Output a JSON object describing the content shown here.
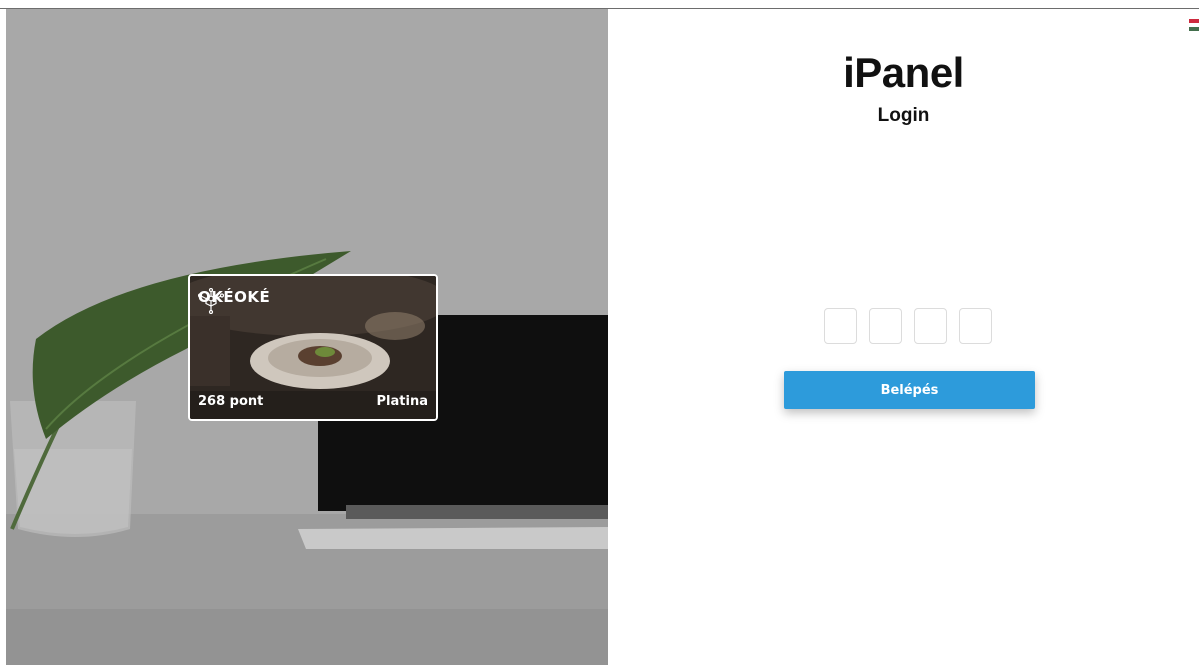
{
  "hero": {
    "card": {
      "brand_name": "OKÉOKÉ",
      "brand_logo_icon": "network-cube-icon",
      "points": "268 pont",
      "tier": "Platina"
    }
  },
  "login": {
    "title": "iPanel",
    "subtitle": "Login",
    "pin_digits": [
      "",
      "",
      "",
      ""
    ],
    "submit_label": "Belépés",
    "language_flag": "hungarian-flag-icon"
  },
  "colors": {
    "accent": "#2d9bdb",
    "hero_overlay": "#a9a9a9",
    "flag_red": "#cd2a3e",
    "flag_white": "#ffffff",
    "flag_green": "#436f4d"
  }
}
